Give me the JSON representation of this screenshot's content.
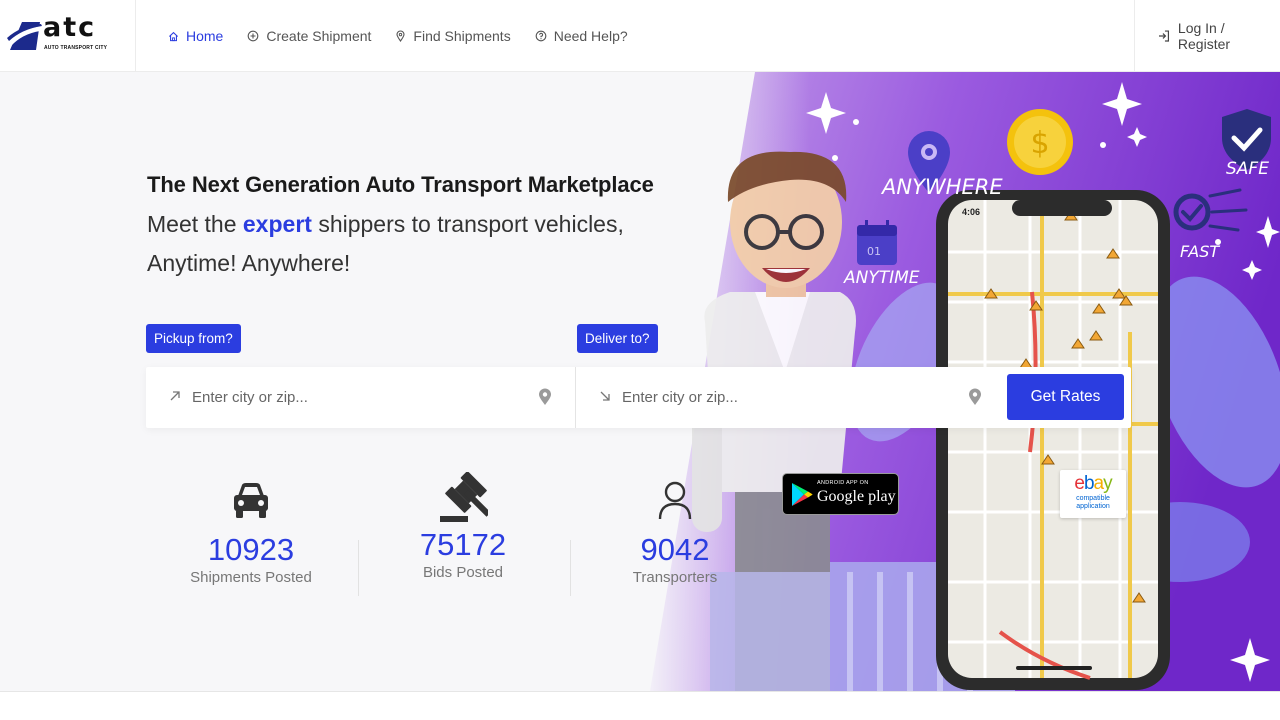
{
  "brand": {
    "logo_text": "atc",
    "logo_subtext": "AUTO TRANSPORT CITY",
    "accent_color": "#2b3de0"
  },
  "nav": {
    "items": [
      {
        "label": "Home",
        "icon": "home-icon",
        "active": true
      },
      {
        "label": "Create Shipment",
        "icon": "plus-circle-icon",
        "active": false
      },
      {
        "label": "Find Shipments",
        "icon": "map-pin-icon",
        "active": false
      },
      {
        "label": "Need Help?",
        "icon": "help-circle-icon",
        "active": false
      }
    ],
    "login_label": "Log In / Register"
  },
  "hero": {
    "headline": "The Next Generation Auto Transport Marketplace",
    "sub_before": "Meet the ",
    "sub_accent": "expert",
    "sub_after": " shippers to transport vehicles, Anytime! Anywhere!"
  },
  "search": {
    "pickup_tag": "Pickup from?",
    "pickup_placeholder": "Enter city or zip...",
    "deliver_tag": "Deliver to?",
    "deliver_placeholder": "Enter city or zip...",
    "button_label": "Get Rates"
  },
  "stats": [
    {
      "value": "10923",
      "label": "Shipments Posted",
      "icon": "car-icon"
    },
    {
      "value": "75172",
      "label": "Bids Posted",
      "icon": "gavel-icon"
    },
    {
      "value": "9042",
      "label": "Transporters",
      "icon": "user-icon"
    }
  ],
  "app_badge": {
    "small_text": "ANDROID APP ON",
    "big_text": "Google play"
  },
  "illustration": {
    "anywhere": "ANYWHERE",
    "anytime": "ANYTIME",
    "safe": "SAFE",
    "fast": "FAST",
    "calendar_day": "01",
    "phone_time": "4:06",
    "ebay_logo": "ebay",
    "ebay_caption_1": "compatible",
    "ebay_caption_2": "application"
  }
}
